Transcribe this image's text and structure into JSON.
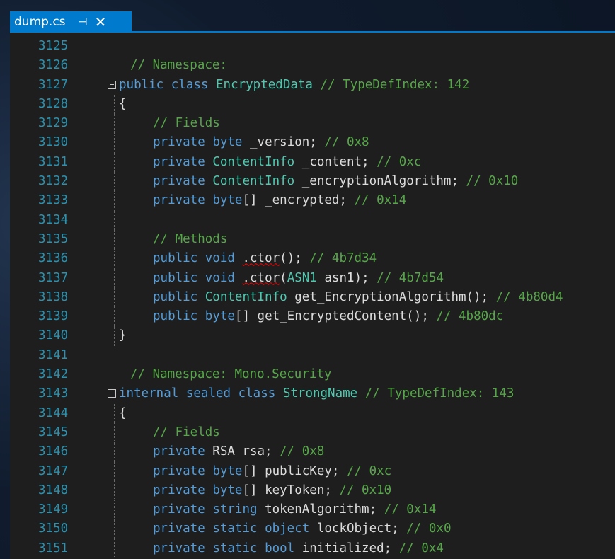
{
  "tab": {
    "title": "dump.cs",
    "pin_glyph": "⊣",
    "close_glyph": "✕"
  },
  "colors": {
    "keyword": "#569cd6",
    "comment": "#57a64a",
    "type": "#4ec9b0",
    "plain": "#dcdcdc",
    "line_number": "#2b91af",
    "tab_accent": "#007acc"
  },
  "lines": [
    {
      "num": "3125",
      "indent": 0,
      "tokens": []
    },
    {
      "num": "3126",
      "indent": 1,
      "tokens": [
        {
          "t": "// Namespace: ",
          "c": "cm"
        }
      ]
    },
    {
      "num": "3127",
      "indent": 0,
      "fold": true,
      "tokens": [
        {
          "t": "public",
          "c": "kw"
        },
        {
          "t": " ",
          "c": "pl"
        },
        {
          "t": "class",
          "c": "kw"
        },
        {
          "t": " ",
          "c": "pl"
        },
        {
          "t": "EncryptedData",
          "c": "ty"
        },
        {
          "t": " ",
          "c": "pl"
        },
        {
          "t": "// TypeDefIndex: 142",
          "c": "cm"
        }
      ]
    },
    {
      "num": "3128",
      "indent": 0,
      "guide": true,
      "tokens": [
        {
          "t": "{",
          "c": "pl"
        }
      ]
    },
    {
      "num": "3129",
      "indent": 2,
      "guide": true,
      "tokens": [
        {
          "t": "// Fields",
          "c": "cm"
        }
      ]
    },
    {
      "num": "3130",
      "indent": 2,
      "guide": true,
      "tokens": [
        {
          "t": "private",
          "c": "kw"
        },
        {
          "t": " ",
          "c": "pl"
        },
        {
          "t": "byte",
          "c": "kw"
        },
        {
          "t": " _version; ",
          "c": "pl"
        },
        {
          "t": "// 0x8",
          "c": "cm"
        }
      ]
    },
    {
      "num": "3131",
      "indent": 2,
      "guide": true,
      "tokens": [
        {
          "t": "private",
          "c": "kw"
        },
        {
          "t": " ",
          "c": "pl"
        },
        {
          "t": "ContentInfo",
          "c": "ty"
        },
        {
          "t": " _content; ",
          "c": "pl"
        },
        {
          "t": "// 0xc",
          "c": "cm"
        }
      ]
    },
    {
      "num": "3132",
      "indent": 2,
      "guide": true,
      "tokens": [
        {
          "t": "private",
          "c": "kw"
        },
        {
          "t": " ",
          "c": "pl"
        },
        {
          "t": "ContentInfo",
          "c": "ty"
        },
        {
          "t": " _encryptionAlgorithm; ",
          "c": "pl"
        },
        {
          "t": "// 0x10",
          "c": "cm"
        }
      ]
    },
    {
      "num": "3133",
      "indent": 2,
      "guide": true,
      "tokens": [
        {
          "t": "private",
          "c": "kw"
        },
        {
          "t": " ",
          "c": "pl"
        },
        {
          "t": "byte",
          "c": "kw"
        },
        {
          "t": "[] _encrypted; ",
          "c": "pl"
        },
        {
          "t": "// 0x14",
          "c": "cm"
        }
      ]
    },
    {
      "num": "3134",
      "indent": 0,
      "guide": true,
      "tokens": []
    },
    {
      "num": "3135",
      "indent": 2,
      "guide": true,
      "tokens": [
        {
          "t": "// Methods",
          "c": "cm"
        }
      ]
    },
    {
      "num": "3136",
      "indent": 2,
      "guide": true,
      "tokens": [
        {
          "t": "public",
          "c": "kw"
        },
        {
          "t": " ",
          "c": "pl"
        },
        {
          "t": "void",
          "c": "kw"
        },
        {
          "t": " ",
          "c": "pl"
        },
        {
          "t": ".ctor",
          "c": "sq"
        },
        {
          "t": "(); ",
          "c": "pl"
        },
        {
          "t": "// 4b7d34",
          "c": "cm"
        }
      ]
    },
    {
      "num": "3137",
      "indent": 2,
      "guide": true,
      "tokens": [
        {
          "t": "public",
          "c": "kw"
        },
        {
          "t": " ",
          "c": "pl"
        },
        {
          "t": "void",
          "c": "kw"
        },
        {
          "t": " ",
          "c": "pl"
        },
        {
          "t": ".ctor",
          "c": "sq"
        },
        {
          "t": "(",
          "c": "pl"
        },
        {
          "t": "ASN1",
          "c": "ty"
        },
        {
          "t": " asn1); ",
          "c": "pl"
        },
        {
          "t": "// 4b7d54",
          "c": "cm"
        }
      ]
    },
    {
      "num": "3138",
      "indent": 2,
      "guide": true,
      "tokens": [
        {
          "t": "public",
          "c": "kw"
        },
        {
          "t": " ",
          "c": "pl"
        },
        {
          "t": "ContentInfo",
          "c": "ty"
        },
        {
          "t": " get_EncryptionAlgorithm(); ",
          "c": "pl"
        },
        {
          "t": "// 4b80d4",
          "c": "cm"
        }
      ]
    },
    {
      "num": "3139",
      "indent": 2,
      "guide": true,
      "tokens": [
        {
          "t": "public",
          "c": "kw"
        },
        {
          "t": " ",
          "c": "pl"
        },
        {
          "t": "byte",
          "c": "kw"
        },
        {
          "t": "[] get_EncryptedContent(); ",
          "c": "pl"
        },
        {
          "t": "// 4b80dc",
          "c": "cm"
        }
      ]
    },
    {
      "num": "3140",
      "indent": 0,
      "guide": true,
      "tokens": [
        {
          "t": "}",
          "c": "pl"
        }
      ]
    },
    {
      "num": "3141",
      "indent": 0,
      "tokens": []
    },
    {
      "num": "3142",
      "indent": 1,
      "tokens": [
        {
          "t": "// Namespace: Mono.Security",
          "c": "cm"
        }
      ]
    },
    {
      "num": "3143",
      "indent": 0,
      "fold": true,
      "tokens": [
        {
          "t": "internal",
          "c": "kw"
        },
        {
          "t": " ",
          "c": "pl"
        },
        {
          "t": "sealed",
          "c": "kw"
        },
        {
          "t": " ",
          "c": "pl"
        },
        {
          "t": "class",
          "c": "kw"
        },
        {
          "t": " ",
          "c": "pl"
        },
        {
          "t": "StrongName",
          "c": "ty"
        },
        {
          "t": " ",
          "c": "pl"
        },
        {
          "t": "// TypeDefIndex: 143",
          "c": "cm"
        }
      ]
    },
    {
      "num": "3144",
      "indent": 0,
      "guide": true,
      "tokens": [
        {
          "t": "{",
          "c": "pl"
        }
      ]
    },
    {
      "num": "3145",
      "indent": 2,
      "guide": true,
      "tokens": [
        {
          "t": "// Fields",
          "c": "cm"
        }
      ]
    },
    {
      "num": "3146",
      "indent": 2,
      "guide": true,
      "tokens": [
        {
          "t": "private",
          "c": "kw"
        },
        {
          "t": " RSA rsa; ",
          "c": "pl"
        },
        {
          "t": "// 0x8",
          "c": "cm"
        }
      ]
    },
    {
      "num": "3147",
      "indent": 2,
      "guide": true,
      "tokens": [
        {
          "t": "private",
          "c": "kw"
        },
        {
          "t": " ",
          "c": "pl"
        },
        {
          "t": "byte",
          "c": "kw"
        },
        {
          "t": "[] publicKey; ",
          "c": "pl"
        },
        {
          "t": "// 0xc",
          "c": "cm"
        }
      ]
    },
    {
      "num": "3148",
      "indent": 2,
      "guide": true,
      "tokens": [
        {
          "t": "private",
          "c": "kw"
        },
        {
          "t": " ",
          "c": "pl"
        },
        {
          "t": "byte",
          "c": "kw"
        },
        {
          "t": "[] keyToken; ",
          "c": "pl"
        },
        {
          "t": "// 0x10",
          "c": "cm"
        }
      ]
    },
    {
      "num": "3149",
      "indent": 2,
      "guide": true,
      "tokens": [
        {
          "t": "private",
          "c": "kw"
        },
        {
          "t": " ",
          "c": "pl"
        },
        {
          "t": "string",
          "c": "kw"
        },
        {
          "t": " tokenAlgorithm; ",
          "c": "pl"
        },
        {
          "t": "// 0x14",
          "c": "cm"
        }
      ]
    },
    {
      "num": "3150",
      "indent": 2,
      "guide": true,
      "tokens": [
        {
          "t": "private",
          "c": "kw"
        },
        {
          "t": " ",
          "c": "pl"
        },
        {
          "t": "static",
          "c": "kw"
        },
        {
          "t": " ",
          "c": "pl"
        },
        {
          "t": "object",
          "c": "kw"
        },
        {
          "t": " lockObject; ",
          "c": "pl"
        },
        {
          "t": "// 0x0",
          "c": "cm"
        }
      ]
    },
    {
      "num": "3151",
      "indent": 2,
      "guide": true,
      "tokens": [
        {
          "t": "private",
          "c": "kw"
        },
        {
          "t": " ",
          "c": "pl"
        },
        {
          "t": "static",
          "c": "kw"
        },
        {
          "t": " ",
          "c": "pl"
        },
        {
          "t": "bool",
          "c": "kw"
        },
        {
          "t": " initialized; ",
          "c": "pl"
        },
        {
          "t": "// 0x4",
          "c": "cm"
        }
      ]
    }
  ]
}
